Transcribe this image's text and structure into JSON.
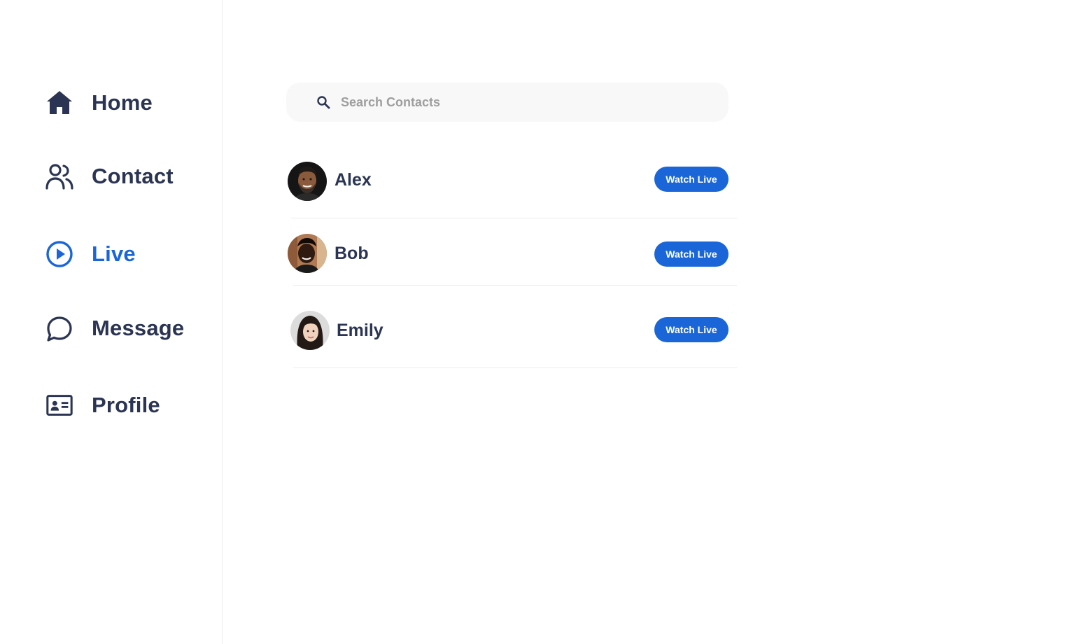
{
  "sidebar": {
    "items": [
      {
        "label": "Home",
        "icon": "home-icon",
        "active": false
      },
      {
        "label": "Contact",
        "icon": "users-icon",
        "active": false
      },
      {
        "label": "Live",
        "icon": "play-circle-icon",
        "active": true
      },
      {
        "label": "Message",
        "icon": "chat-bubble-icon",
        "active": false
      },
      {
        "label": "Profile",
        "icon": "id-card-icon",
        "active": false
      }
    ]
  },
  "search": {
    "placeholder": "Search Contacts",
    "value": ""
  },
  "contacts": [
    {
      "name": "Alex",
      "button_label": "Watch Live"
    },
    {
      "name": "Bob",
      "button_label": "Watch Live"
    },
    {
      "name": "Emily",
      "button_label": "Watch Live"
    }
  ],
  "colors": {
    "accent": "#1a66d8",
    "text": "#2b3553",
    "placeholder": "#9e9e9e",
    "search_bg": "#f8f8f8",
    "divider": "#ececec"
  }
}
